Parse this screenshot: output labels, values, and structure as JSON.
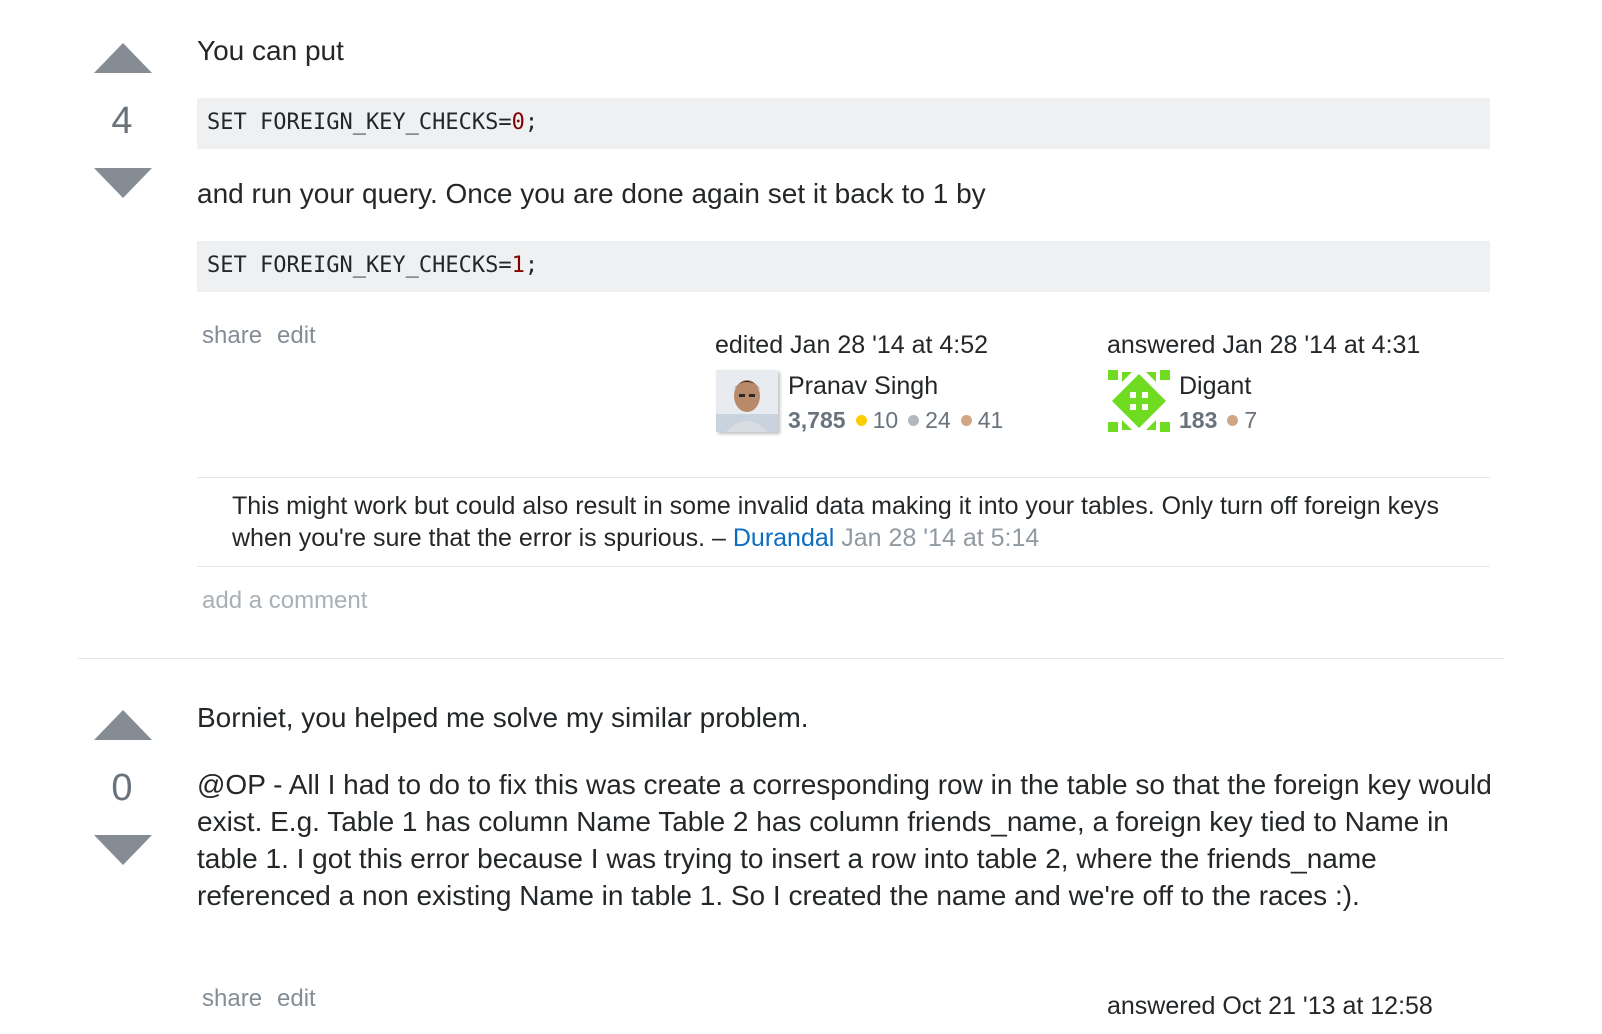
{
  "answers": [
    {
      "votes": "4",
      "intro": "You can put",
      "code1": {
        "prefix": "SET FOREIGN_KEY_CHECKS=",
        "num": "0",
        "suffix": ";"
      },
      "middle": "and run your query. Once you are done again set it back to 1 by",
      "code2": {
        "prefix": "SET FOREIGN_KEY_CHECKS=",
        "num": "1",
        "suffix": ";"
      },
      "share_label": "share",
      "edit_label": "edit",
      "edited": {
        "action": "edited Jan 28 '14 at 4:52",
        "user": "Pranav Singh",
        "rep": "3,785",
        "gold": "10",
        "silver": "24",
        "bronze": "41"
      },
      "answered": {
        "action": "answered Jan 28 '14 at 4:31",
        "user": "Digant",
        "rep": "183",
        "bronze": "7"
      },
      "comment": {
        "text": "This might work but could also result in some invalid data making it into your tables. Only turn off foreign keys when you're sure that the error is spurious. –",
        "user": "Durandal",
        "date": "Jan 28 '14 at 5:14"
      },
      "add_comment": "add a comment"
    },
    {
      "votes": "0",
      "p1": "Borniet, you helped me solve my similar problem.",
      "p2": "@OP - All I had to do to fix this was create a corresponding row in the table so that the foreign key would exist. E.g. Table 1 has column Name Table 2 has column friends_name, a foreign key tied to Name in table 1. I got this error because I was trying to insert a row into table 2, where the friends_name referenced a non existing Name in table 1. So I created the name and we're off to the races :).",
      "share_label": "share",
      "edit_label": "edit",
      "answered": {
        "action": "answered Oct 21 '13 at 12:58"
      }
    }
  ],
  "icons": {
    "upvote": "triangle-up",
    "downvote": "triangle-down"
  },
  "colors": {
    "link": "#0c6cc4",
    "muted": "#848d95",
    "code_bg": "#eff0f1",
    "code_number": "#800000",
    "badge_gold": "#ffcc01",
    "badge_silver": "#b4b8bc",
    "badge_bronze": "#d1a684"
  }
}
